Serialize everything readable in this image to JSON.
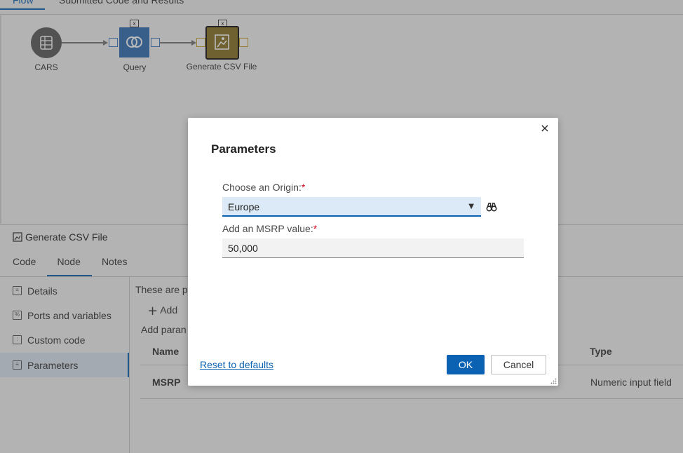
{
  "top_tabs": [
    "Flow",
    "Submitted Code and Results"
  ],
  "flow": {
    "nodes": [
      {
        "label": "CARS",
        "icon": "table-icon"
      },
      {
        "label": "Query",
        "icon": "query-join-icon"
      },
      {
        "label": "Generate CSV File",
        "icon": "csv-export-icon"
      }
    ]
  },
  "bottom_panel": {
    "title": "Generate CSV File",
    "tabs": [
      "Code",
      "Node",
      "Notes"
    ],
    "active_tab": "Node",
    "sidebar": [
      {
        "label": "Details",
        "icon": "details-icon"
      },
      {
        "label": "Ports and variables",
        "icon": "percent-icon"
      },
      {
        "label": "Custom code",
        "icon": "code-icon"
      },
      {
        "label": "Parameters",
        "icon": "parameters-icon"
      }
    ],
    "content": {
      "intro_text": "These are p",
      "add_label": "Add",
      "add_param_text": "Add paran",
      "col_name": "Name",
      "col_type": "Type",
      "row_name": "MSRP",
      "row_type": "Numeric input field"
    }
  },
  "dialog": {
    "title": "Parameters",
    "origin_label": "Choose an Origin:",
    "origin_value": "Europe",
    "msrp_label": "Add an MSRP value:",
    "msrp_value": "50,000",
    "required_marker": "*",
    "reset_label": "Reset to defaults",
    "ok_label": "OK",
    "cancel_label": "Cancel",
    "close_glyph": "×"
  },
  "colors": {
    "accent": "#0b62b3",
    "select_bg": "#dce9f6",
    "required": "#d0021b",
    "node_blue": "#2f6db3",
    "node_gold": "#8a7224"
  }
}
